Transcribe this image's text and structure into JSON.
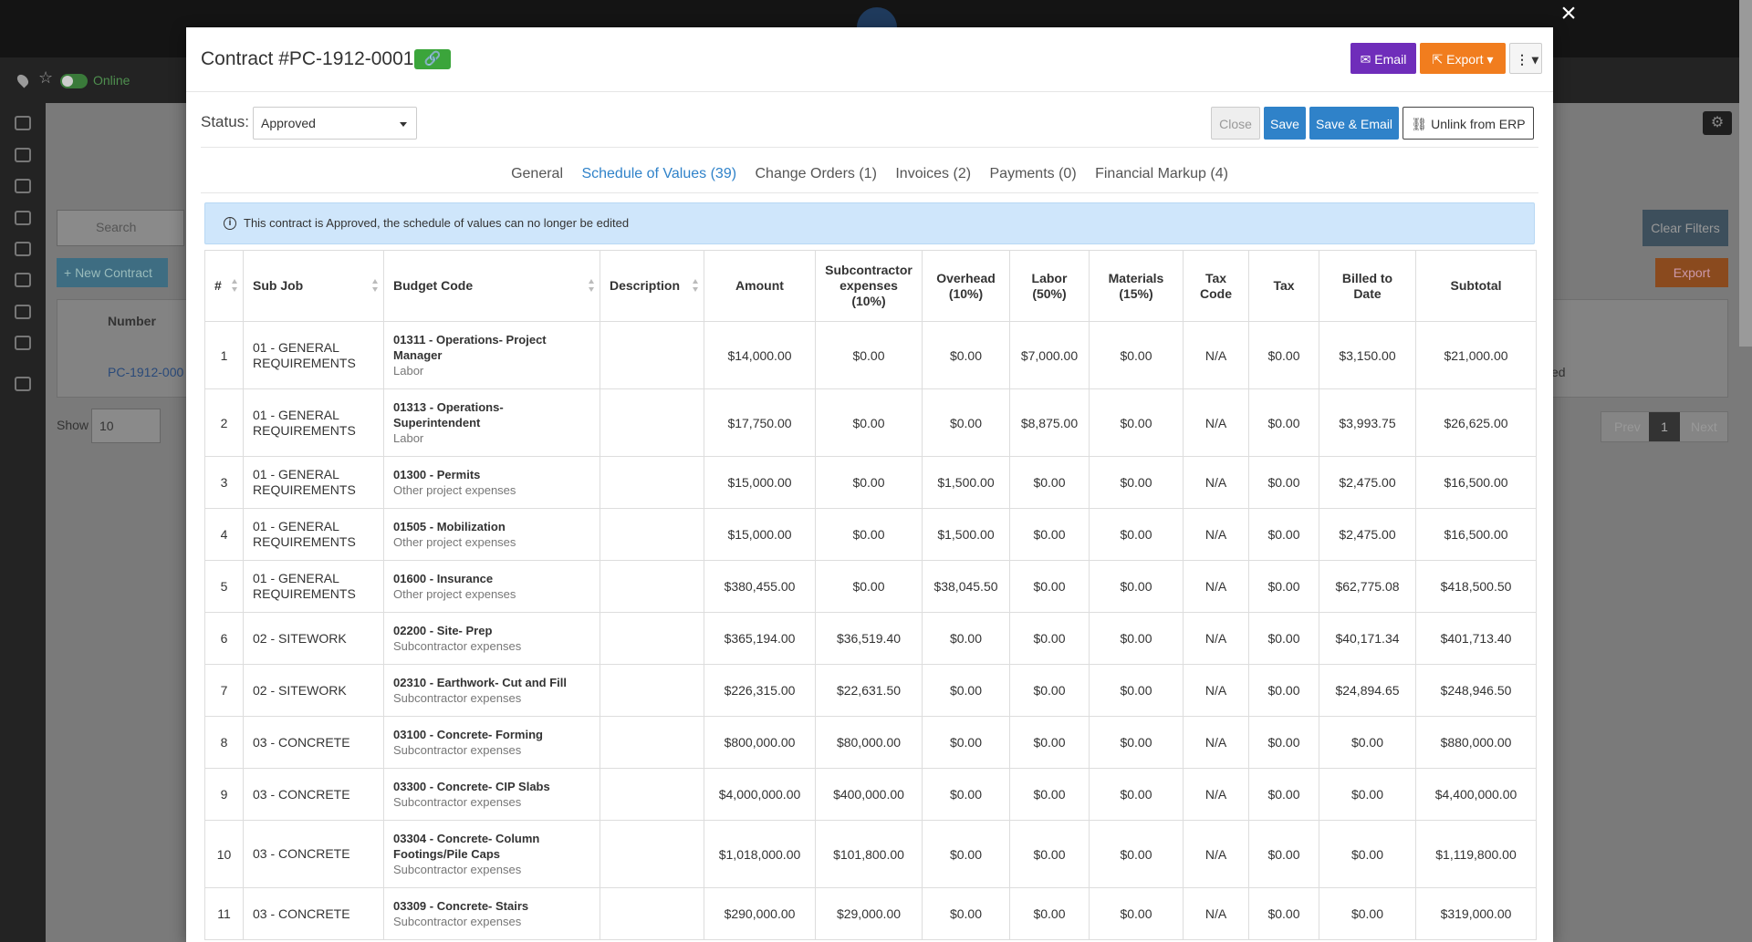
{
  "background": {
    "online_label": "Online",
    "search_placeholder": "Search",
    "clear_filters_label": "Clear Filters",
    "new_contract_label": "+ New Contract",
    "export_label": "Export",
    "number_header": "Number",
    "contract_link": "PC-1912-000",
    "row_status_fragment": "ed",
    "show_label": "Show",
    "show_value": "10",
    "pager": {
      "prev": "Prev",
      "current": "1",
      "next": "Next"
    }
  },
  "modal": {
    "title": "Contract #PC-1912-0001",
    "email_label": "Email",
    "export_label": "Export",
    "status_label": "Status:",
    "status_value": "Approved",
    "close_label": "Close",
    "save_label": "Save",
    "save_email_label": "Save & Email",
    "unlink_label": "Unlink from ERP",
    "tabs": [
      {
        "label": "General",
        "active": false
      },
      {
        "label": "Schedule of Values (39)",
        "active": true
      },
      {
        "label": "Change Orders (1)",
        "active": false
      },
      {
        "label": "Invoices (2)",
        "active": false
      },
      {
        "label": "Payments (0)",
        "active": false
      },
      {
        "label": "Financial Markup (4)",
        "active": false
      }
    ],
    "alert_text": "This contract is Approved, the schedule of values can no longer be edited"
  },
  "table": {
    "headers": {
      "num": "#",
      "subjob": "Sub Job",
      "budget": "Budget Code",
      "desc": "Description",
      "amount": "Amount",
      "sub_a": "Subcontractor",
      "sub_b": "expenses",
      "sub_c": "(10%)",
      "oh_a": "Overhead",
      "oh_b": "(10%)",
      "labor_a": "Labor",
      "labor_b": "(50%)",
      "mat_a": "Materials",
      "mat_b": "(15%)",
      "taxcode_a": "Tax",
      "taxcode_b": "Code",
      "tax": "Tax",
      "billed_a": "Billed to",
      "billed_b": "Date",
      "subtotal": "Subtotal"
    },
    "rows": [
      {
        "num": "1",
        "sj1": "01 - GENERAL",
        "sj2": "REQUIREMENTS",
        "c1": "01311 - Operations- Project",
        "c2": "Manager",
        "ct": "Labor",
        "desc": "",
        "amount": "$14,000.00",
        "sub": "$0.00",
        "oh": "$0.00",
        "labor": "$7,000.00",
        "mat": "$0.00",
        "taxcode": "N/A",
        "tax": "$0.00",
        "billed": "$3,150.00",
        "subtotal": "$21,000.00"
      },
      {
        "num": "2",
        "sj1": "01 - GENERAL",
        "sj2": "REQUIREMENTS",
        "c1": "01313 - Operations-",
        "c2": "Superintendent",
        "ct": "Labor",
        "desc": "",
        "amount": "$17,750.00",
        "sub": "$0.00",
        "oh": "$0.00",
        "labor": "$8,875.00",
        "mat": "$0.00",
        "taxcode": "N/A",
        "tax": "$0.00",
        "billed": "$3,993.75",
        "subtotal": "$26,625.00"
      },
      {
        "num": "3",
        "sj1": "01 - GENERAL",
        "sj2": "REQUIREMENTS",
        "c1": "01300 - Permits",
        "c2": "",
        "ct": "Other project expenses",
        "desc": "",
        "amount": "$15,000.00",
        "sub": "$0.00",
        "oh": "$1,500.00",
        "labor": "$0.00",
        "mat": "$0.00",
        "taxcode": "N/A",
        "tax": "$0.00",
        "billed": "$2,475.00",
        "subtotal": "$16,500.00"
      },
      {
        "num": "4",
        "sj1": "01 - GENERAL",
        "sj2": "REQUIREMENTS",
        "c1": "01505 - Mobilization",
        "c2": "",
        "ct": "Other project expenses",
        "desc": "",
        "amount": "$15,000.00",
        "sub": "$0.00",
        "oh": "$1,500.00",
        "labor": "$0.00",
        "mat": "$0.00",
        "taxcode": "N/A",
        "tax": "$0.00",
        "billed": "$2,475.00",
        "subtotal": "$16,500.00"
      },
      {
        "num": "5",
        "sj1": "01 - GENERAL",
        "sj2": "REQUIREMENTS",
        "c1": "01600 - Insurance",
        "c2": "",
        "ct": "Other project expenses",
        "desc": "",
        "amount": "$380,455.00",
        "sub": "$0.00",
        "oh": "$38,045.50",
        "labor": "$0.00",
        "mat": "$0.00",
        "taxcode": "N/A",
        "tax": "$0.00",
        "billed": "$62,775.08",
        "subtotal": "$418,500.50"
      },
      {
        "num": "6",
        "sj1": "02 - SITEWORK",
        "sj2": "",
        "c1": "02200 - Site- Prep",
        "c2": "",
        "ct": "Subcontractor expenses",
        "desc": "",
        "amount": "$365,194.00",
        "sub": "$36,519.40",
        "oh": "$0.00",
        "labor": "$0.00",
        "mat": "$0.00",
        "taxcode": "N/A",
        "tax": "$0.00",
        "billed": "$40,171.34",
        "subtotal": "$401,713.40"
      },
      {
        "num": "7",
        "sj1": "02 - SITEWORK",
        "sj2": "",
        "c1": "02310 - Earthwork- Cut and Fill",
        "c2": "",
        "ct": "Subcontractor expenses",
        "desc": "",
        "amount": "$226,315.00",
        "sub": "$22,631.50",
        "oh": "$0.00",
        "labor": "$0.00",
        "mat": "$0.00",
        "taxcode": "N/A",
        "tax": "$0.00",
        "billed": "$24,894.65",
        "subtotal": "$248,946.50"
      },
      {
        "num": "8",
        "sj1": "03 - CONCRETE",
        "sj2": "",
        "c1": "03100 - Concrete- Forming",
        "c2": "",
        "ct": "Subcontractor expenses",
        "desc": "",
        "amount": "$800,000.00",
        "sub": "$80,000.00",
        "oh": "$0.00",
        "labor": "$0.00",
        "mat": "$0.00",
        "taxcode": "N/A",
        "tax": "$0.00",
        "billed": "$0.00",
        "subtotal": "$880,000.00"
      },
      {
        "num": "9",
        "sj1": "03 - CONCRETE",
        "sj2": "",
        "c1": "03300 - Concrete- CIP Slabs",
        "c2": "",
        "ct": "Subcontractor expenses",
        "desc": "",
        "amount": "$4,000,000.00",
        "sub": "$400,000.00",
        "oh": "$0.00",
        "labor": "$0.00",
        "mat": "$0.00",
        "taxcode": "N/A",
        "tax": "$0.00",
        "billed": "$0.00",
        "subtotal": "$4,400,000.00"
      },
      {
        "num": "10",
        "sj1": "03 - CONCRETE",
        "sj2": "",
        "c1": "03304 - Concrete- Column",
        "c2": "Footings/Pile Caps",
        "ct": "Subcontractor expenses",
        "desc": "",
        "amount": "$1,018,000.00",
        "sub": "$101,800.00",
        "oh": "$0.00",
        "labor": "$0.00",
        "mat": "$0.00",
        "taxcode": "N/A",
        "tax": "$0.00",
        "billed": "$0.00",
        "subtotal": "$1,119,800.00"
      },
      {
        "num": "11",
        "sj1": "03 - CONCRETE",
        "sj2": "",
        "c1": "03309 - Concrete- Stairs",
        "c2": "",
        "ct": "Subcontractor expenses",
        "desc": "",
        "amount": "$290,000.00",
        "sub": "$29,000.00",
        "oh": "$0.00",
        "labor": "$0.00",
        "mat": "$0.00",
        "taxcode": "N/A",
        "tax": "$0.00",
        "billed": "$0.00",
        "subtotal": "$319,000.00"
      }
    ]
  }
}
